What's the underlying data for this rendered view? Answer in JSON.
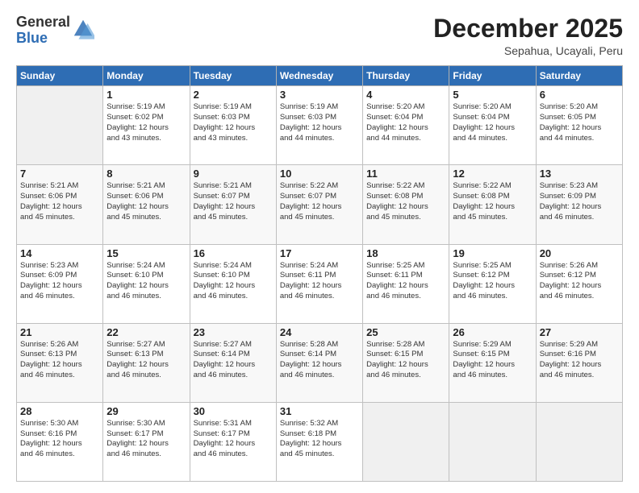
{
  "logo": {
    "general": "General",
    "blue": "Blue"
  },
  "header": {
    "month": "December 2025",
    "location": "Sepahua, Ucayali, Peru"
  },
  "weekdays": [
    "Sunday",
    "Monday",
    "Tuesday",
    "Wednesday",
    "Thursday",
    "Friday",
    "Saturday"
  ],
  "weeks": [
    [
      {
        "day": "",
        "sunrise": "",
        "sunset": "",
        "daylight": ""
      },
      {
        "day": "1",
        "sunrise": "Sunrise: 5:19 AM",
        "sunset": "Sunset: 6:02 PM",
        "daylight": "Daylight: 12 hours and 43 minutes."
      },
      {
        "day": "2",
        "sunrise": "Sunrise: 5:19 AM",
        "sunset": "Sunset: 6:03 PM",
        "daylight": "Daylight: 12 hours and 43 minutes."
      },
      {
        "day": "3",
        "sunrise": "Sunrise: 5:19 AM",
        "sunset": "Sunset: 6:03 PM",
        "daylight": "Daylight: 12 hours and 44 minutes."
      },
      {
        "day": "4",
        "sunrise": "Sunrise: 5:20 AM",
        "sunset": "Sunset: 6:04 PM",
        "daylight": "Daylight: 12 hours and 44 minutes."
      },
      {
        "day": "5",
        "sunrise": "Sunrise: 5:20 AM",
        "sunset": "Sunset: 6:04 PM",
        "daylight": "Daylight: 12 hours and 44 minutes."
      },
      {
        "day": "6",
        "sunrise": "Sunrise: 5:20 AM",
        "sunset": "Sunset: 6:05 PM",
        "daylight": "Daylight: 12 hours and 44 minutes."
      }
    ],
    [
      {
        "day": "7",
        "sunrise": "Sunrise: 5:21 AM",
        "sunset": "Sunset: 6:06 PM",
        "daylight": "Daylight: 12 hours and 45 minutes."
      },
      {
        "day": "8",
        "sunrise": "Sunrise: 5:21 AM",
        "sunset": "Sunset: 6:06 PM",
        "daylight": "Daylight: 12 hours and 45 minutes."
      },
      {
        "day": "9",
        "sunrise": "Sunrise: 5:21 AM",
        "sunset": "Sunset: 6:07 PM",
        "daylight": "Daylight: 12 hours and 45 minutes."
      },
      {
        "day": "10",
        "sunrise": "Sunrise: 5:22 AM",
        "sunset": "Sunset: 6:07 PM",
        "daylight": "Daylight: 12 hours and 45 minutes."
      },
      {
        "day": "11",
        "sunrise": "Sunrise: 5:22 AM",
        "sunset": "Sunset: 6:08 PM",
        "daylight": "Daylight: 12 hours and 45 minutes."
      },
      {
        "day": "12",
        "sunrise": "Sunrise: 5:22 AM",
        "sunset": "Sunset: 6:08 PM",
        "daylight": "Daylight: 12 hours and 45 minutes."
      },
      {
        "day": "13",
        "sunrise": "Sunrise: 5:23 AM",
        "sunset": "Sunset: 6:09 PM",
        "daylight": "Daylight: 12 hours and 46 minutes."
      }
    ],
    [
      {
        "day": "14",
        "sunrise": "Sunrise: 5:23 AM",
        "sunset": "Sunset: 6:09 PM",
        "daylight": "Daylight: 12 hours and 46 minutes."
      },
      {
        "day": "15",
        "sunrise": "Sunrise: 5:24 AM",
        "sunset": "Sunset: 6:10 PM",
        "daylight": "Daylight: 12 hours and 46 minutes."
      },
      {
        "day": "16",
        "sunrise": "Sunrise: 5:24 AM",
        "sunset": "Sunset: 6:10 PM",
        "daylight": "Daylight: 12 hours and 46 minutes."
      },
      {
        "day": "17",
        "sunrise": "Sunrise: 5:24 AM",
        "sunset": "Sunset: 6:11 PM",
        "daylight": "Daylight: 12 hours and 46 minutes."
      },
      {
        "day": "18",
        "sunrise": "Sunrise: 5:25 AM",
        "sunset": "Sunset: 6:11 PM",
        "daylight": "Daylight: 12 hours and 46 minutes."
      },
      {
        "day": "19",
        "sunrise": "Sunrise: 5:25 AM",
        "sunset": "Sunset: 6:12 PM",
        "daylight": "Daylight: 12 hours and 46 minutes."
      },
      {
        "day": "20",
        "sunrise": "Sunrise: 5:26 AM",
        "sunset": "Sunset: 6:12 PM",
        "daylight": "Daylight: 12 hours and 46 minutes."
      }
    ],
    [
      {
        "day": "21",
        "sunrise": "Sunrise: 5:26 AM",
        "sunset": "Sunset: 6:13 PM",
        "daylight": "Daylight: 12 hours and 46 minutes."
      },
      {
        "day": "22",
        "sunrise": "Sunrise: 5:27 AM",
        "sunset": "Sunset: 6:13 PM",
        "daylight": "Daylight: 12 hours and 46 minutes."
      },
      {
        "day": "23",
        "sunrise": "Sunrise: 5:27 AM",
        "sunset": "Sunset: 6:14 PM",
        "daylight": "Daylight: 12 hours and 46 minutes."
      },
      {
        "day": "24",
        "sunrise": "Sunrise: 5:28 AM",
        "sunset": "Sunset: 6:14 PM",
        "daylight": "Daylight: 12 hours and 46 minutes."
      },
      {
        "day": "25",
        "sunrise": "Sunrise: 5:28 AM",
        "sunset": "Sunset: 6:15 PM",
        "daylight": "Daylight: 12 hours and 46 minutes."
      },
      {
        "day": "26",
        "sunrise": "Sunrise: 5:29 AM",
        "sunset": "Sunset: 6:15 PM",
        "daylight": "Daylight: 12 hours and 46 minutes."
      },
      {
        "day": "27",
        "sunrise": "Sunrise: 5:29 AM",
        "sunset": "Sunset: 6:16 PM",
        "daylight": "Daylight: 12 hours and 46 minutes."
      }
    ],
    [
      {
        "day": "28",
        "sunrise": "Sunrise: 5:30 AM",
        "sunset": "Sunset: 6:16 PM",
        "daylight": "Daylight: 12 hours and 46 minutes."
      },
      {
        "day": "29",
        "sunrise": "Sunrise: 5:30 AM",
        "sunset": "Sunset: 6:17 PM",
        "daylight": "Daylight: 12 hours and 46 minutes."
      },
      {
        "day": "30",
        "sunrise": "Sunrise: 5:31 AM",
        "sunset": "Sunset: 6:17 PM",
        "daylight": "Daylight: 12 hours and 46 minutes."
      },
      {
        "day": "31",
        "sunrise": "Sunrise: 5:32 AM",
        "sunset": "Sunset: 6:18 PM",
        "daylight": "Daylight: 12 hours and 45 minutes."
      },
      {
        "day": "",
        "sunrise": "",
        "sunset": "",
        "daylight": ""
      },
      {
        "day": "",
        "sunrise": "",
        "sunset": "",
        "daylight": ""
      },
      {
        "day": "",
        "sunrise": "",
        "sunset": "",
        "daylight": ""
      }
    ]
  ]
}
